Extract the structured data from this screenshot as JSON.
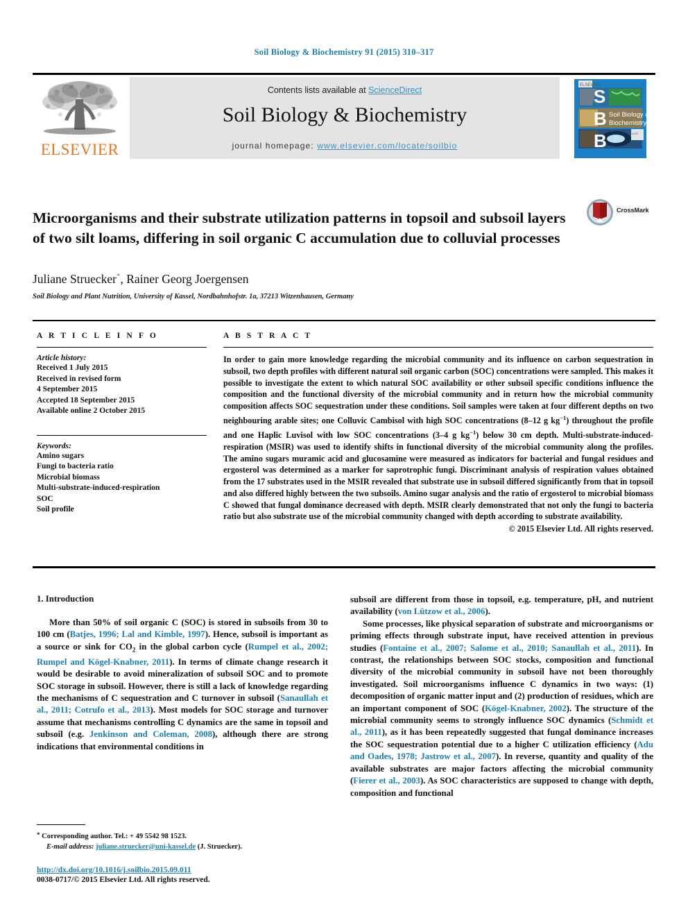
{
  "running_head": "Soil Biology & Biochemistry 91 (2015) 310–317",
  "masthead": {
    "contents_prefix": "Contents lists available at ",
    "sciencedirect": "ScienceDirect",
    "journal_title": "Soil Biology & Biochemistry",
    "homepage_prefix": "journal homepage: ",
    "homepage_url": "www.elsevier.com/locate/soilbio",
    "publisher": "ELSEVIER",
    "cover_letters": "SBB",
    "cover_title_line1": "Soil Biology &",
    "cover_title_line2": "Biochemistry"
  },
  "article": {
    "title": "Microorganisms and their substrate utilization patterns in topsoil and subsoil layers of two silt loams, differing in soil organic C accumulation due to colluvial processes",
    "authors": "Juliane Struecker",
    "authors_rest": ", Rainer Georg Joergensen",
    "affiliation": "Soil Biology and Plant Nutrition, University of Kassel, Nordbahnhofstr. 1a, 37213 Witzenhausen, Germany",
    "crossmark_label": "CrossMark"
  },
  "info": {
    "heading": "A R T I C L E   I N F O",
    "history_label": "Article history:",
    "history": [
      "Received 1 July 2015",
      "Received in revised form",
      "4 September 2015",
      "Accepted 18 September 2015",
      "Available online 2 October 2015"
    ],
    "keywords_label": "Keywords:",
    "keywords": [
      "Amino sugars",
      "Fungi to bacteria ratio",
      "Microbial biomass",
      "Multi-substrate-induced-respiration",
      "SOC",
      "Soil profile"
    ]
  },
  "abstract": {
    "heading": "A B S T R A C T",
    "part1": "In order to gain more knowledge regarding the microbial community and its influence on carbon sequestration in subsoil, two depth profiles with different natural soil organic carbon (SOC) concentrations were sampled. This makes it possible to investigate the extent to which natural SOC availability or other subsoil specific conditions influence the composition and the functional diversity of the microbial community and in return how the microbial community composition affects SOC sequestration under these conditions. Soil samples were taken at four different depths on two neighbouring arable sites; one Colluvic Cambisol with high SOC concentrations (8–12 g kg",
    "sup1": "−1",
    "part2": ") throughout the profile and one Haplic Luvisol with low SOC concentrations (3–4 g kg",
    "sup2": "−1",
    "part3": ") below 30 cm depth. Multi-substrate-induced-respiration (MSIR) was used to identify shifts in functional diversity of the microbial community along the profiles. The amino sugars muramic acid and glucosamine were measured as indicators for bacterial and fungal residues and ergosterol was determined as a marker for saprotrophic fungi. Discriminant analysis of respiration values obtained from the 17 substrates used in the MSIR revealed that substrate use in subsoil differed significantly from that in topsoil and also differed highly between the two subsoils. Amino sugar analysis and the ratio of ergosterol to microbial biomass C showed that fungal dominance decreased with depth. MSIR clearly demonstrated that not only the fungi to bacteria ratio but also substrate use of the microbial community changed with depth according to substrate availability.",
    "copyright": "© 2015 Elsevier Ltd. All rights reserved."
  },
  "body": {
    "intro_heading": "1. Introduction",
    "left_p1_a": "More than 50% of soil organic C (SOC) is stored in subsoils from 30 to 100 cm (",
    "left_p1_ref1": "Batjes, 1996; Lal and Kimble, 1997",
    "left_p1_b": "). Hence, subsoil is important as a source or sink for CO",
    "left_p1_sub": "2",
    "left_p1_c": " in the global carbon cycle (",
    "left_p1_ref2": "Rumpel et al., 2002; Rumpel and Kögel-Knabner, 2011",
    "left_p1_d": "). In terms of climate change research it would be desirable to avoid mineralization of subsoil SOC and to promote SOC storage in subsoil. However, there is still a lack of knowledge regarding the mechanisms of C sequestration and C turnover in subsoil (",
    "left_p1_ref3": "Sanaullah et al., 2011; Cotrufo et al., 2013",
    "left_p1_e": "). Most models for SOC storage and turnover assume that mechanisms controlling C dynamics are the same in topsoil and subsoil (e.g. ",
    "left_p1_ref4": "Jenkinson and Coleman, 2008",
    "left_p1_f": "), although there are strong indications that environmental conditions in",
    "right_p1_a": "subsoil are different from those in topsoil, e.g. temperature, pH, and nutrient availability (",
    "right_p1_ref1": "von Lützow et al., 2006",
    "right_p1_b": ").",
    "right_p2_a": "Some processes, like physical separation of substrate and microorganisms or priming effects through substrate input, have received attention in previous studies (",
    "right_p2_ref1": "Fontaine et al., 2007; Salome et al., 2010; Sanaullah et al., 2011",
    "right_p2_b": "). In contrast, the relationships between SOC stocks, composition and functional diversity of the microbial community in subsoil have not been thoroughly investigated. Soil microorganisms influence C dynamics in two ways: (1) decomposition of organic matter input and (2) production of residues, which are an important component of SOC (",
    "right_p2_ref2": "Kögel-Knabner, 2002",
    "right_p2_c": "). The structure of the microbial community seems to strongly influence SOC dynamics (",
    "right_p2_ref3": "Schmidt et al., 2011",
    "right_p2_d": "), as it has been repeatedly suggested that fungal dominance increases the SOC sequestration potential due to a higher C utilization efficiency (",
    "right_p2_ref4": "Adu and Oades, 1978; Jastrow et al., 2007",
    "right_p2_e": "). In reverse, quantity and quality of the available substrates are major factors affecting the microbial community (",
    "right_p2_ref5": "Fierer et al., 2003",
    "right_p2_f": "). As SOC characteristics are supposed to change with depth, composition and functional"
  },
  "footer": {
    "corresponding": " Corresponding author. Tel.: + 49 5542 98 1523.",
    "email_label": "E-mail address: ",
    "email": "juliane.struecker@uni-kassel.de",
    "email_suffix": " (J. Struecker).",
    "doi": "http://dx.doi.org/10.1016/j.soilbio.2015.09.011",
    "issn": "0038-0717/© 2015 Elsevier Ltd. All rights reserved."
  },
  "colors": {
    "link_blue": "#1a7fb5",
    "sciencedirect_blue": "#3c8fc4",
    "elsevier_orange": "#e87722",
    "cover_blue": "#1b80c4",
    "band_grey": "#e4e4e4"
  }
}
